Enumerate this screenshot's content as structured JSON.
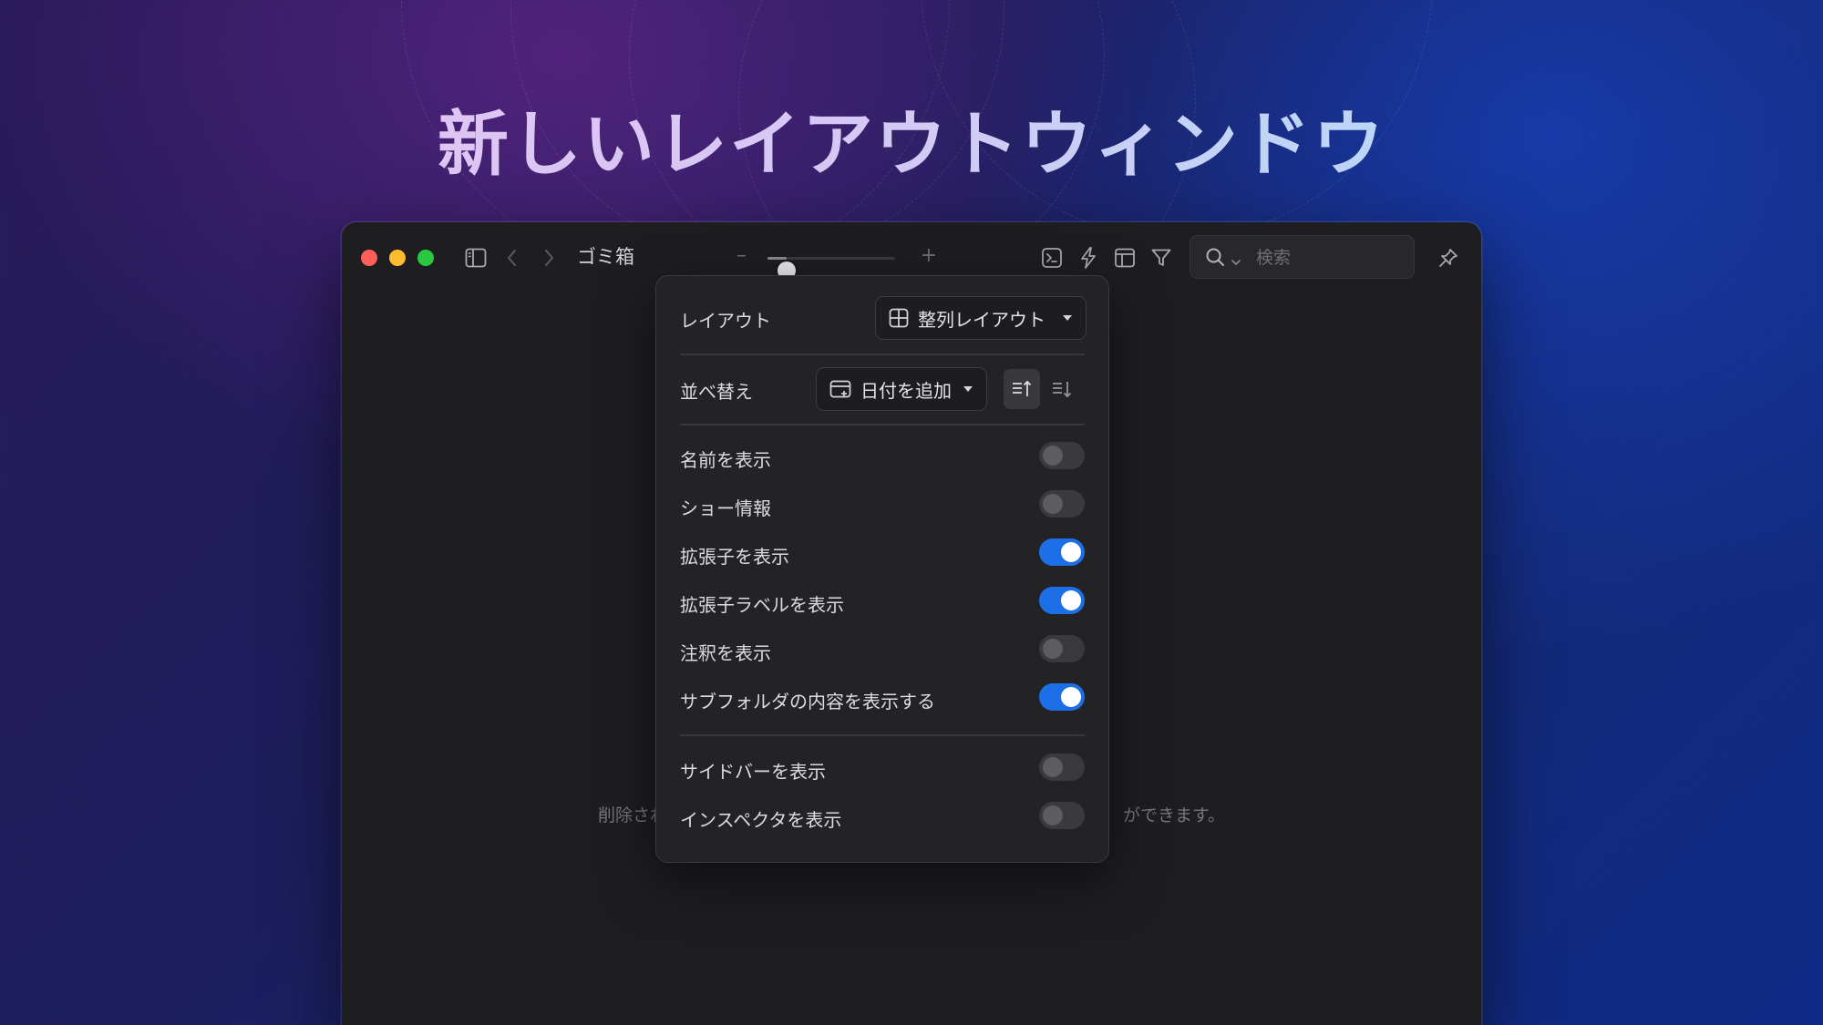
{
  "hero": {
    "title": "新しいレイアウトウィンドウ"
  },
  "window": {
    "title": "ゴミ箱",
    "zoom": {
      "minus": "–",
      "plus": "+",
      "value": 0.15
    },
    "search": {
      "placeholder": "検索"
    },
    "empty_state": {
      "left_fragment": "削除され",
      "right_fragment": "ができます。"
    }
  },
  "popover": {
    "layout": {
      "label": "レイアウト",
      "value": "整列レイアウト"
    },
    "sort": {
      "label": "並べ替え",
      "value": "日付を追加"
    },
    "toggles": [
      {
        "label": "名前を表示",
        "on": false
      },
      {
        "label": "ショー情報",
        "on": false
      },
      {
        "label": "拡張子を表示",
        "on": true
      },
      {
        "label": "拡張子ラベルを表示",
        "on": true
      },
      {
        "label": "注釈を表示",
        "on": false
      },
      {
        "label": "サブフォルダの内容を表示する",
        "on": true
      }
    ],
    "toggles2": [
      {
        "label": "サイドバーを表示",
        "on": false
      },
      {
        "label": "インスペクタを表示",
        "on": false
      }
    ]
  },
  "colors": {
    "accent": "#1d6fe8",
    "close": "#ff5f57",
    "minimize": "#febc2e",
    "zoom": "#28c840"
  },
  "icons": {
    "sidebar": "sidebar-icon",
    "back": "chevron-left-icon",
    "forward": "chevron-right-icon",
    "terminal": "terminal-icon",
    "action": "bolt-icon",
    "layout": "layout-icon",
    "filter": "filter-icon",
    "search": "search-icon",
    "pin": "pin-icon"
  }
}
